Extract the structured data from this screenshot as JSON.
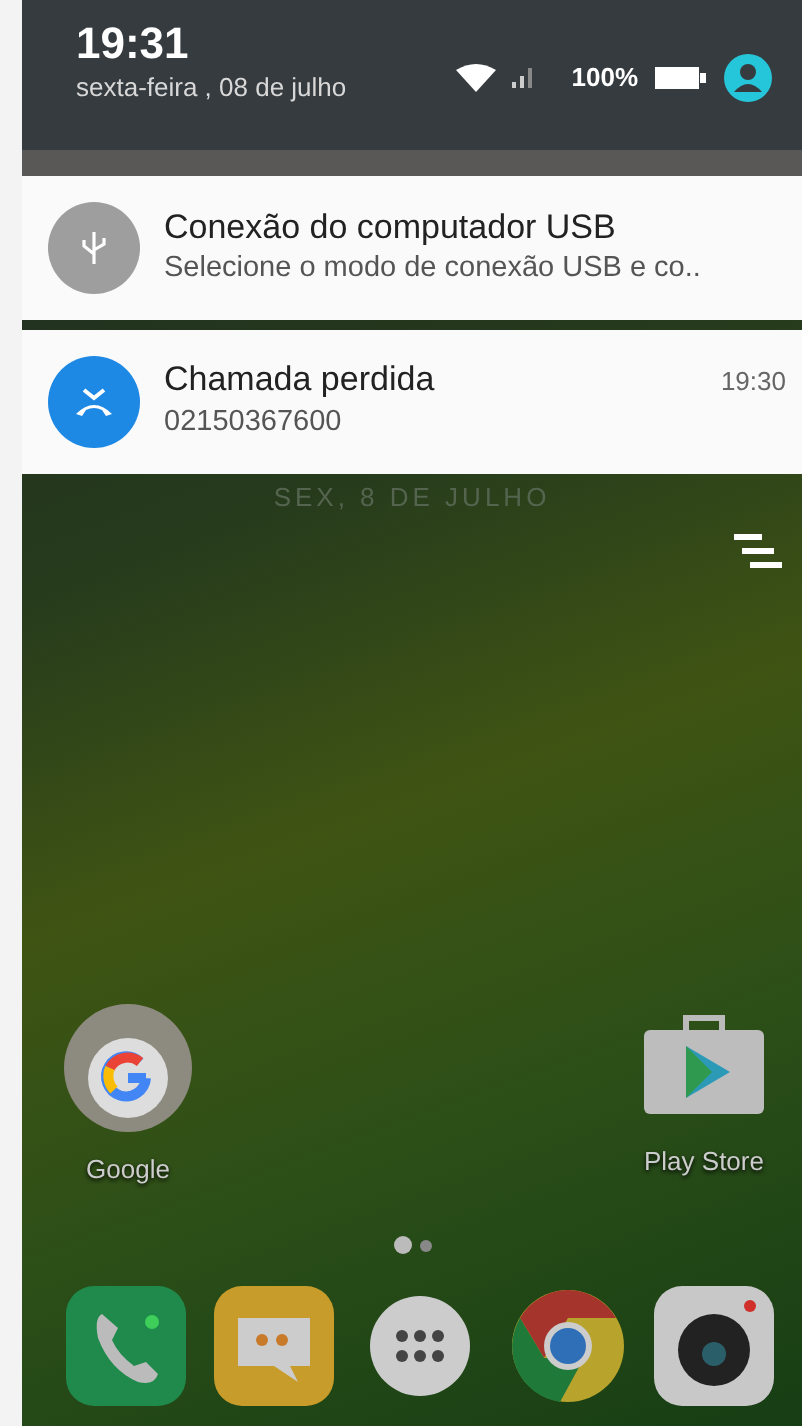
{
  "status_header": {
    "time": "19:31",
    "date": "sexta-feira , 08 de julho",
    "battery": "100%"
  },
  "notifications": [
    {
      "kind": "usb",
      "title": "Conexão do computador USB",
      "text": "Selecione o modo de conexão USB e co.."
    },
    {
      "kind": "missed-call",
      "title": "Chamada perdida",
      "text": "02150367600",
      "time": "19:30"
    }
  ],
  "lock_date": "SEX, 8 DE JULHO",
  "home_apps": [
    {
      "kind": "google",
      "label": "Google"
    },
    {
      "kind": "store",
      "label": "Play Store"
    }
  ],
  "page_dots": [
    {
      "selected": true
    },
    {
      "selected": false
    }
  ],
  "dock": [
    {
      "kind": "phone"
    },
    {
      "kind": "messages"
    },
    {
      "kind": "apps"
    },
    {
      "kind": "browser"
    },
    {
      "kind": "camera"
    }
  ]
}
